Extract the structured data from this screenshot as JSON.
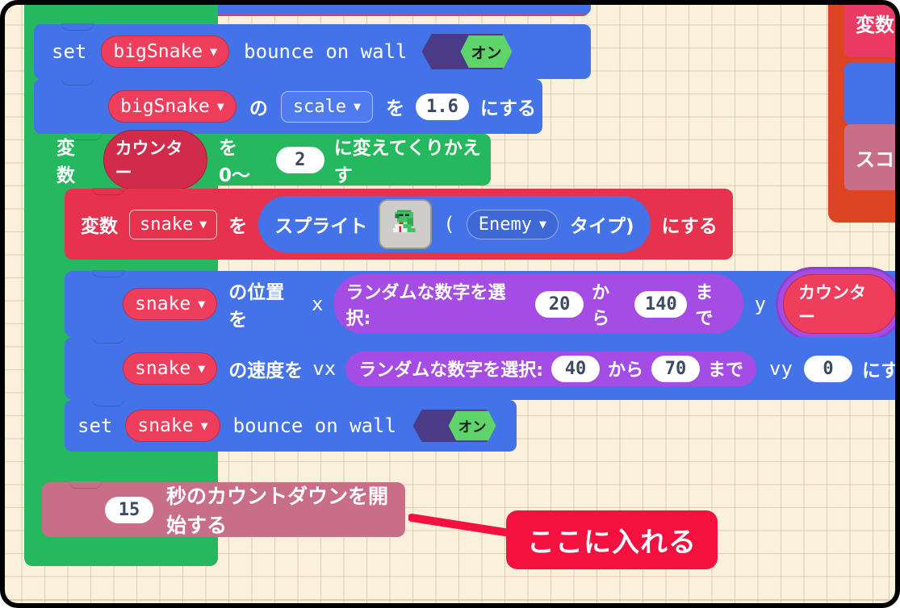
{
  "editor": {
    "background_color": "#fbf0dc",
    "grid": true,
    "name": "block-code-workspace"
  },
  "colors": {
    "blue_block": "#4472e8",
    "red_block": "#e6324f",
    "green_loop": "#25b85e",
    "purple_reporter": "#a54ce4",
    "rose_block": "#c96e89",
    "orange_container": "#dd4423",
    "callout_red": "#f4113f",
    "toggle_on_green": "#5fd46a",
    "toggle_track": "#4b3b86"
  },
  "blocks": {
    "set_bounce_big": {
      "set_label": "set",
      "variable": "bigSnake",
      "text": "bounce on wall",
      "toggle_value": "オン"
    },
    "set_scale": {
      "variable": "bigSnake",
      "no_particle": "の",
      "property": "scale",
      "wo_particle": "を",
      "value": "1.6",
      "suffix": "にする"
    },
    "repeat_loop": {
      "prefix": "変数",
      "variable": "カウンター",
      "from_label": "を0〜",
      "to_value": "2",
      "suffix": "に変えてくりかえす"
    },
    "set_sprite": {
      "prefix": "変数",
      "variable": "snake",
      "wo_particle": "を",
      "sprite_label": "スプライト",
      "sprite_icon": "snake-sprite-icon",
      "paren_open": "(",
      "kind": "Enemy",
      "kind_suffix": "タイプ)",
      "suffix": "にする"
    },
    "set_position": {
      "variable": "snake",
      "label": "の位置を",
      "x_label": "x",
      "x_random": {
        "label": "ランダムな数字を選択:",
        "from": "20",
        "from_label": "から",
        "to": "140",
        "to_label": "まで"
      },
      "y_label": "y",
      "y_variable": "カウンター"
    },
    "set_velocity": {
      "variable": "snake",
      "label": "の速度を",
      "vx_label": "vx",
      "vx_random": {
        "label": "ランダムな数字を選択:",
        "from": "40",
        "from_label": "から",
        "to": "70",
        "to_label": "まで"
      },
      "vy_label": "vy",
      "vy_value": "0",
      "suffix": "にす"
    },
    "set_bounce_snake": {
      "set_label": "set",
      "variable": "snake",
      "text": "bounce on wall",
      "toggle_value": "オン"
    },
    "countdown": {
      "value": "15",
      "label": "秒のカウントダウンを開始する"
    }
  },
  "right_panel": {
    "block_1_label": "変数",
    "block_3_label": "スコア"
  },
  "annotation": {
    "callout_text": "ここに入れる",
    "arrow": "pointer-arrow"
  }
}
